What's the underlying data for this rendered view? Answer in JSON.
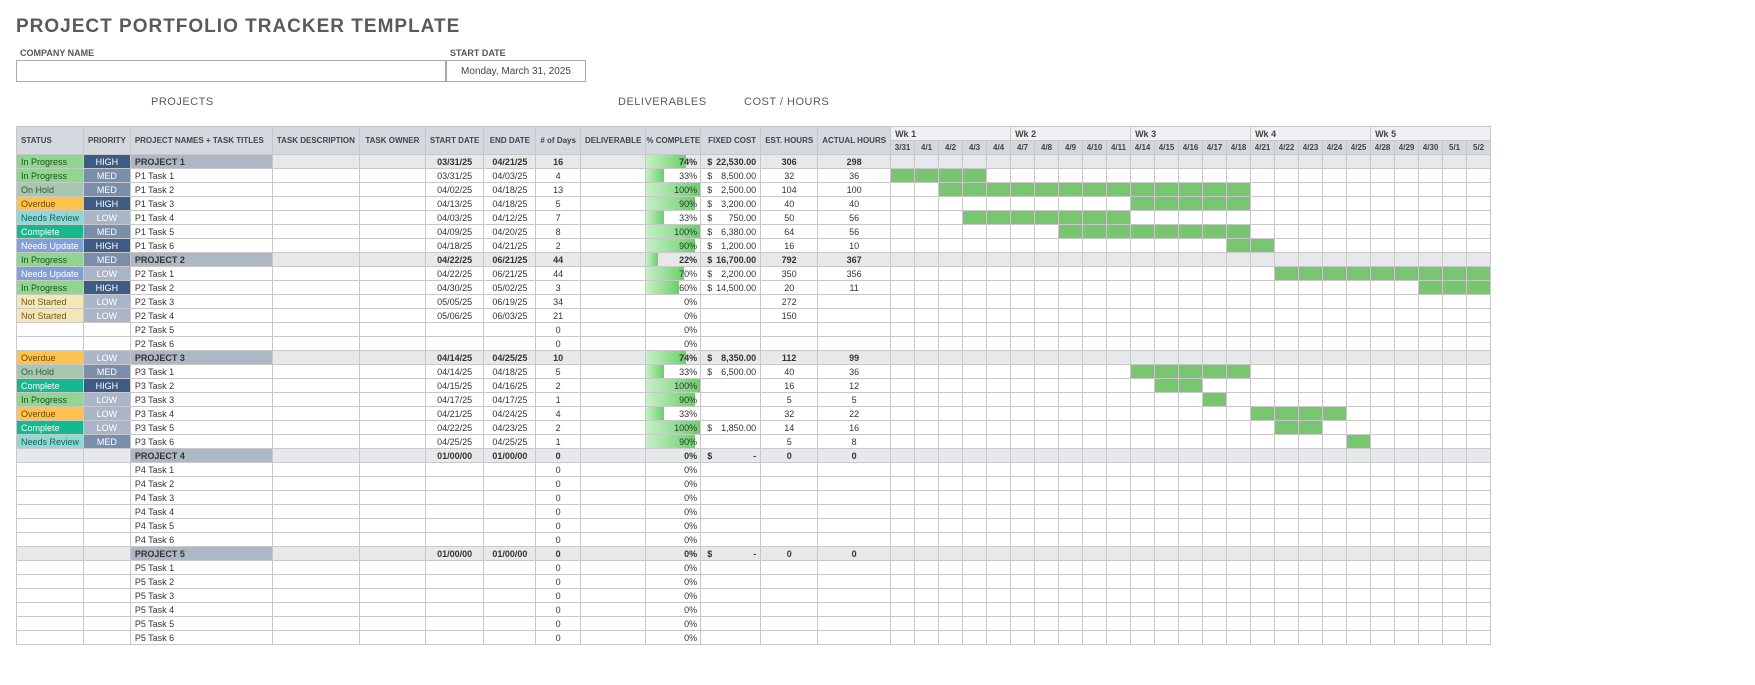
{
  "title": "PROJECT PORTFOLIO TRACKER TEMPLATE",
  "meta": {
    "company_label": "COMPANY NAME",
    "company_value": "",
    "startdate_label": "START DATE",
    "startdate_value": "Monday, March 31, 2025"
  },
  "section_headers": {
    "projects": "PROJECTS",
    "deliverables": "DELIVERABLES",
    "cost": "COST / HOURS"
  },
  "columns": {
    "status": "STATUS",
    "priority": "PRIORITY",
    "name": "PROJECT NAMES + TASK TITLES",
    "desc": "TASK DESCRIPTION",
    "owner": "TASK OWNER",
    "start": "START DATE",
    "end": "END DATE",
    "days": "# of Days",
    "deliv": "DELIVERABLE",
    "pct": "% COMPLETE",
    "cost": "FIXED COST",
    "est": "EST. HOURS",
    "act": "ACTUAL HOURS"
  },
  "weeks": [
    {
      "label": "Wk 1",
      "days": [
        "3/31",
        "4/1",
        "4/2",
        "4/3",
        "4/4"
      ]
    },
    {
      "label": "Wk 2",
      "days": [
        "4/7",
        "4/8",
        "4/9",
        "4/10",
        "4/11"
      ]
    },
    {
      "label": "Wk 3",
      "days": [
        "4/14",
        "4/15",
        "4/16",
        "4/17",
        "4/18"
      ]
    },
    {
      "label": "Wk 4",
      "days": [
        "4/21",
        "4/22",
        "4/23",
        "4/24",
        "4/25"
      ]
    },
    {
      "label": "Wk 5",
      "days": [
        "4/28",
        "4/29",
        "4/30",
        "5/1",
        "5/2"
      ]
    }
  ],
  "rows": [
    {
      "type": "project",
      "status": "In Progress",
      "priority": "HIGH",
      "name": "PROJECT 1",
      "start": "03/31/25",
      "end": "04/21/25",
      "days": "16",
      "pct": 74,
      "cost": "22,530.00",
      "est": "306",
      "act": "298",
      "gantt": [
        0,
        15
      ]
    },
    {
      "type": "task",
      "status": "In Progress",
      "priority": "MED",
      "name": "P1 Task 1",
      "start": "03/31/25",
      "end": "04/03/25",
      "days": "4",
      "pct": 33,
      "cost": "8,500.00",
      "est": "32",
      "act": "36",
      "gantt": [
        0,
        3
      ]
    },
    {
      "type": "task",
      "status": "On Hold",
      "priority": "MED",
      "name": "P1 Task 2",
      "start": "04/02/25",
      "end": "04/18/25",
      "days": "13",
      "pct": 100,
      "cost": "2,500.00",
      "est": "104",
      "act": "100",
      "gantt": [
        2,
        14
      ]
    },
    {
      "type": "task",
      "status": "Overdue",
      "priority": "HIGH",
      "name": "P1 Task 3",
      "start": "04/13/25",
      "end": "04/18/25",
      "days": "5",
      "pct": 90,
      "cost": "3,200.00",
      "est": "40",
      "act": "40",
      "gantt": [
        10,
        14
      ]
    },
    {
      "type": "task",
      "status": "Needs Review",
      "priority": "LOW",
      "name": "P1 Task 4",
      "start": "04/03/25",
      "end": "04/12/25",
      "days": "7",
      "pct": 33,
      "cost": "750.00",
      "est": "50",
      "act": "56",
      "gantt": [
        3,
        9
      ]
    },
    {
      "type": "task",
      "status": "Complete",
      "priority": "MED",
      "name": "P1 Task 5",
      "start": "04/09/25",
      "end": "04/20/25",
      "days": "8",
      "pct": 100,
      "cost": "6,380.00",
      "est": "64",
      "act": "56",
      "gantt": [
        7,
        14
      ]
    },
    {
      "type": "task",
      "status": "Needs Update",
      "priority": "HIGH",
      "name": "P1 Task 6",
      "start": "04/18/25",
      "end": "04/21/25",
      "days": "2",
      "pct": 90,
      "cost": "1,200.00",
      "est": "16",
      "act": "10",
      "gantt": [
        14,
        15
      ]
    },
    {
      "type": "project",
      "status": "In Progress",
      "priority": "MED",
      "name": "PROJECT 2",
      "start": "04/22/25",
      "end": "06/21/25",
      "days": "44",
      "pct": 22,
      "cost": "16,700.00",
      "est": "792",
      "act": "367",
      "gantt": [
        16,
        24
      ]
    },
    {
      "type": "task",
      "status": "Needs Update",
      "priority": "LOW",
      "name": "P2 Task 1",
      "start": "04/22/25",
      "end": "06/21/25",
      "days": "44",
      "pct": 70,
      "cost": "2,200.00",
      "est": "350",
      "act": "356",
      "gantt": [
        16,
        24
      ]
    },
    {
      "type": "task",
      "status": "In Progress",
      "priority": "HIGH",
      "name": "P2 Task 2",
      "start": "04/30/25",
      "end": "05/02/25",
      "days": "3",
      "pct": 60,
      "cost": "14,500.00",
      "est": "20",
      "act": "11",
      "gantt": [
        22,
        24
      ]
    },
    {
      "type": "task",
      "status": "Not Started",
      "priority": "LOW",
      "name": "P2 Task 3",
      "start": "05/05/25",
      "end": "06/19/25",
      "days": "34",
      "pct": 0,
      "est": "272",
      "gantt": null
    },
    {
      "type": "task",
      "status": "Not Started",
      "priority": "LOW",
      "name": "P2 Task 4",
      "start": "05/06/25",
      "end": "06/03/25",
      "days": "21",
      "pct": 0,
      "est": "150",
      "gantt": null
    },
    {
      "type": "task",
      "name": "P2 Task 5",
      "days": "0",
      "pct": 0,
      "gantt": null
    },
    {
      "type": "task",
      "name": "P2 Task 6",
      "days": "0",
      "pct": 0,
      "gantt": null
    },
    {
      "type": "project",
      "status": "Overdue",
      "priority": "LOW",
      "name": "PROJECT 3",
      "start": "04/14/25",
      "end": "04/25/25",
      "days": "10",
      "pct": 74,
      "cost": "8,350.00",
      "est": "112",
      "act": "99",
      "gantt": [
        10,
        19
      ]
    },
    {
      "type": "task",
      "status": "On Hold",
      "priority": "MED",
      "name": "P3 Task 1",
      "start": "04/14/25",
      "end": "04/18/25",
      "days": "5",
      "pct": 33,
      "cost": "6,500.00",
      "est": "40",
      "act": "36",
      "gantt": [
        10,
        14
      ]
    },
    {
      "type": "task",
      "status": "Complete",
      "priority": "HIGH",
      "name": "P3 Task 2",
      "start": "04/15/25",
      "end": "04/16/25",
      "days": "2",
      "pct": 100,
      "est": "16",
      "act": "12",
      "gantt": [
        11,
        12
      ]
    },
    {
      "type": "task",
      "status": "In Progress",
      "priority": "LOW",
      "name": "P3 Task 3",
      "start": "04/17/25",
      "end": "04/17/25",
      "days": "1",
      "pct": 90,
      "est": "5",
      "act": "5",
      "gantt": [
        13,
        13
      ]
    },
    {
      "type": "task",
      "status": "Overdue",
      "priority": "LOW",
      "name": "P3 Task 4",
      "start": "04/21/25",
      "end": "04/24/25",
      "days": "4",
      "pct": 33,
      "est": "32",
      "act": "22",
      "gantt": [
        15,
        18
      ]
    },
    {
      "type": "task",
      "status": "Complete",
      "priority": "LOW",
      "name": "P3 Task 5",
      "start": "04/22/25",
      "end": "04/23/25",
      "days": "2",
      "pct": 100,
      "cost": "1,850.00",
      "est": "14",
      "act": "16",
      "gantt": [
        16,
        17
      ]
    },
    {
      "type": "task",
      "status": "Needs Review",
      "priority": "MED",
      "name": "P3 Task 6",
      "start": "04/25/25",
      "end": "04/25/25",
      "days": "1",
      "pct": 90,
      "est": "5",
      "act": "8",
      "gantt": [
        19,
        19
      ]
    },
    {
      "type": "project",
      "name": "PROJECT 4",
      "start": "01/00/00",
      "end": "01/00/00",
      "days": "0",
      "pct": 0,
      "cost": "-",
      "est": "0",
      "act": "0",
      "gantt": null
    },
    {
      "type": "task",
      "name": "P4 Task 1",
      "days": "0",
      "pct": 0,
      "gantt": null
    },
    {
      "type": "task",
      "name": "P4 Task 2",
      "days": "0",
      "pct": 0,
      "gantt": null
    },
    {
      "type": "task",
      "name": "P4 Task 3",
      "days": "0",
      "pct": 0,
      "gantt": null
    },
    {
      "type": "task",
      "name": "P4 Task 4",
      "days": "0",
      "pct": 0,
      "gantt": null
    },
    {
      "type": "task",
      "name": "P4 Task 5",
      "days": "0",
      "pct": 0,
      "gantt": null
    },
    {
      "type": "task",
      "name": "P4 Task 6",
      "days": "0",
      "pct": 0,
      "gantt": null
    },
    {
      "type": "project",
      "name": "PROJECT 5",
      "start": "01/00/00",
      "end": "01/00/00",
      "days": "0",
      "pct": 0,
      "cost": "-",
      "est": "0",
      "act": "0",
      "gantt": null
    },
    {
      "type": "task",
      "name": "P5 Task 1",
      "days": "0",
      "pct": 0,
      "gantt": null
    },
    {
      "type": "task",
      "name": "P5 Task 2",
      "days": "0",
      "pct": 0,
      "gantt": null
    },
    {
      "type": "task",
      "name": "P5 Task 3",
      "days": "0",
      "pct": 0,
      "gantt": null
    },
    {
      "type": "task",
      "name": "P5 Task 4",
      "days": "0",
      "pct": 0,
      "gantt": null
    },
    {
      "type": "task",
      "name": "P5 Task 5",
      "days": "0",
      "pct": 0,
      "gantt": null
    },
    {
      "type": "task",
      "name": "P5 Task 6",
      "days": "0",
      "pct": 0,
      "gantt": null
    }
  ],
  "status_classes": {
    "In Progress": "st-inprogress",
    "On Hold": "st-onhold",
    "Overdue": "st-overdue",
    "Needs Review": "st-needsreview",
    "Complete": "st-complete",
    "Needs Update": "st-needsupdate",
    "Not Started": "st-notstarted"
  },
  "priority_classes": {
    "HIGH": "pr-high",
    "MED": "pr-med",
    "LOW": "pr-low"
  }
}
